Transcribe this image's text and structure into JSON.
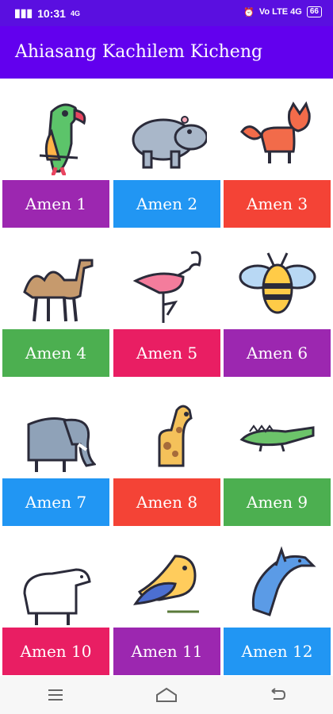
{
  "status": {
    "time": "10:31",
    "network_left": "4G",
    "network_right": "Vo LTE 4G",
    "battery": "66"
  },
  "app": {
    "title": "Ahiasang Kachilem Kicheng"
  },
  "items": [
    {
      "label": "Amen 1",
      "icon": "parrot-icon",
      "color": "#9c27b0"
    },
    {
      "label": "Amen 2",
      "icon": "hippo-icon",
      "color": "#2196f3"
    },
    {
      "label": "Amen 3",
      "icon": "fox-icon",
      "color": "#f44336"
    },
    {
      "label": "Amen 4",
      "icon": "camel-icon",
      "color": "#4caf50"
    },
    {
      "label": "Amen 5",
      "icon": "flamingo-icon",
      "color": "#e91e63"
    },
    {
      "label": "Amen 6",
      "icon": "bee-icon",
      "color": "#9c27b0"
    },
    {
      "label": "Amen 7",
      "icon": "elephant-icon",
      "color": "#2196f3"
    },
    {
      "label": "Amen 8",
      "icon": "giraffe-icon",
      "color": "#f44336"
    },
    {
      "label": "Amen 9",
      "icon": "crocodile-icon",
      "color": "#4caf50"
    },
    {
      "label": "Amen 10",
      "icon": "polar-bear-icon",
      "color": "#e91e63"
    },
    {
      "label": "Amen 11",
      "icon": "bird-icon",
      "color": "#9c27b0"
    },
    {
      "label": "Amen 12",
      "icon": "dolphin-icon",
      "color": "#2196f3"
    }
  ],
  "nav": {
    "menu_icon": "menu-icon",
    "home_icon": "home-icon",
    "back_icon": "back-icon"
  }
}
